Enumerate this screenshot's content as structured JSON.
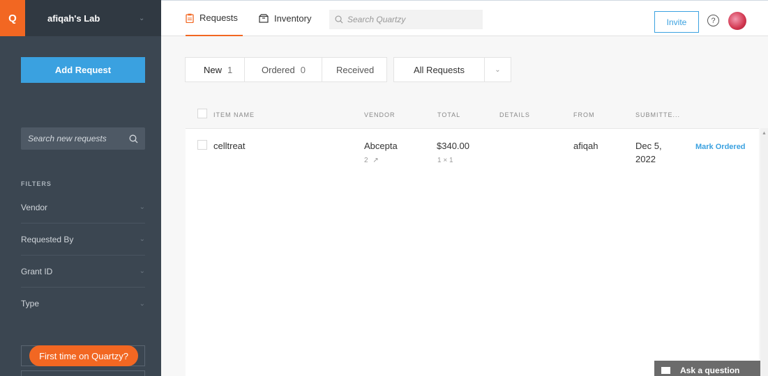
{
  "sidebar": {
    "logo_letter": "Q",
    "lab_name": "afiqah's Lab",
    "add_request_label": "Add Request",
    "search_placeholder": "Search new requests",
    "filters_heading": "FILTERS",
    "filters": [
      {
        "label": "Vendor"
      },
      {
        "label": "Requested By"
      },
      {
        "label": "Grant ID"
      },
      {
        "label": "Type"
      }
    ],
    "first_time_label": "First time on Quartzy?"
  },
  "topbar": {
    "tabs": [
      {
        "label": "Requests",
        "icon": "clipboard-icon",
        "active": true
      },
      {
        "label": "Inventory",
        "icon": "box-icon",
        "active": false
      }
    ],
    "search_placeholder": "Search Quartzy",
    "invite_label": "Invite",
    "help_symbol": "?"
  },
  "status_tabs": [
    {
      "label": "New",
      "count": "1"
    },
    {
      "label": "Ordered",
      "count": "0"
    },
    {
      "label": "Received",
      "count": ""
    }
  ],
  "filter_dropdown": {
    "label": "All Requests"
  },
  "table": {
    "headers": {
      "item_name": "ITEM NAME",
      "vendor": "VENDOR",
      "total": "TOTAL",
      "details": "DETAILS",
      "from": "FROM",
      "submitted": "SUBMITTE..."
    },
    "rows": [
      {
        "item_name": "celltreat",
        "vendor": "Abcepta",
        "vendor_links": "2",
        "total": "$340.00",
        "quantity": "1 × 1",
        "details": "",
        "from": "afiqah",
        "submitted_line1": "Dec 5,",
        "submitted_line2": "2022",
        "action": "Mark Ordered"
      }
    ]
  },
  "help_widget": {
    "label": "Ask a question"
  },
  "colors": {
    "accent": "#f26722",
    "primary": "#3aa1e0",
    "sidebar": "#3b4651"
  }
}
